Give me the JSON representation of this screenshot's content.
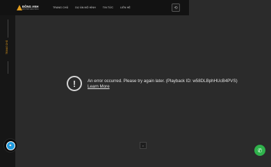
{
  "header": {
    "logo": {
      "brand": "ĐÔNG ANH",
      "tagline": "MÔ HÌNH KIẾN TRÚC"
    },
    "nav": [
      {
        "label": "TRANG CHỦ"
      },
      {
        "label": "DỰ ÁN MÔ HÌNH"
      },
      {
        "label": "TIN TỨC"
      },
      {
        "label": "LIÊN HỆ"
      }
    ],
    "action_icon": "refresh-icon"
  },
  "sidebar": {
    "label": "TRANG CHỦ"
  },
  "player": {
    "error_message": "An error occurred. Please try again later. (Playback ID: w58DLBphHUcB4PVS)",
    "learn_more": "Learn More"
  },
  "widgets": {
    "chat_icon": "chat-icon",
    "phone_icon": "phone-icon"
  },
  "colors": {
    "accent": "#e09a1c",
    "background": "#2b2b2b",
    "header": "#121212",
    "phone": "#2fb24b",
    "chat": "#1d9be0"
  }
}
